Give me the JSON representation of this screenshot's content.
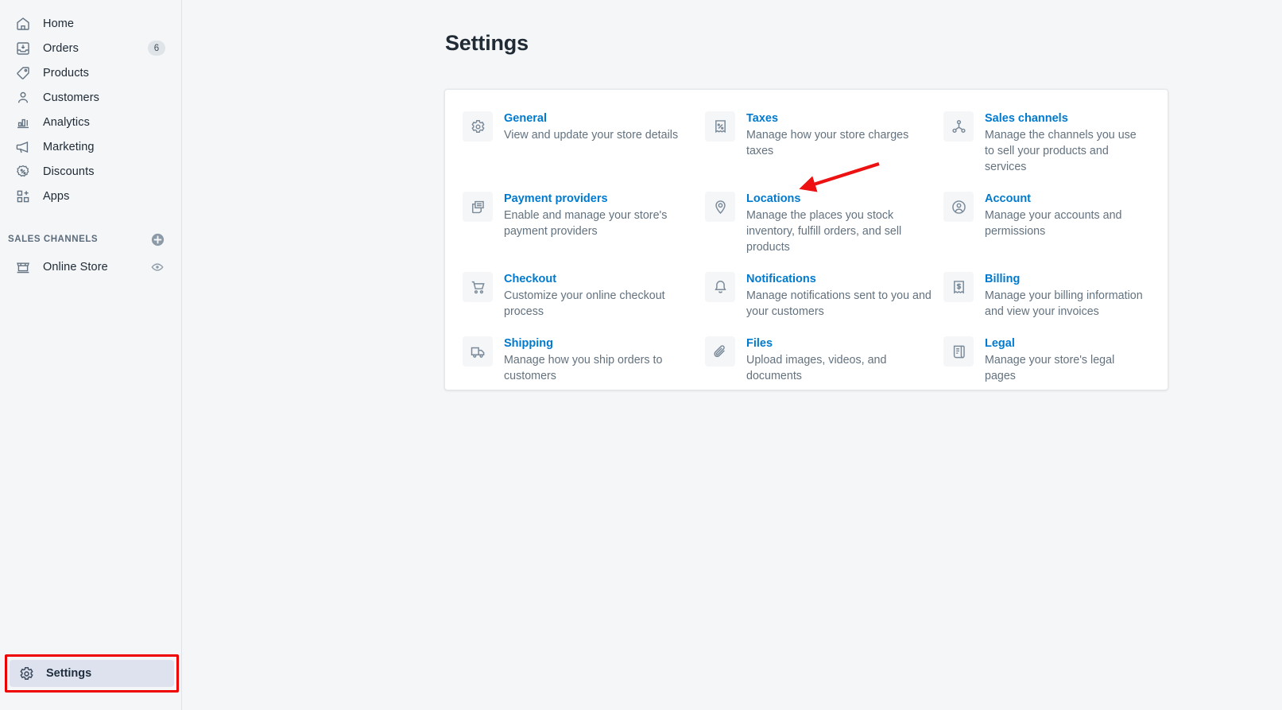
{
  "sidebar": {
    "items": [
      {
        "label": "Home",
        "icon": "home-icon",
        "badge": null
      },
      {
        "label": "Orders",
        "icon": "orders-icon",
        "badge": "6"
      },
      {
        "label": "Products",
        "icon": "products-tag-icon",
        "badge": null
      },
      {
        "label": "Customers",
        "icon": "customers-icon",
        "badge": null
      },
      {
        "label": "Analytics",
        "icon": "analytics-bar-chart-icon",
        "badge": null
      },
      {
        "label": "Marketing",
        "icon": "marketing-megaphone-icon",
        "badge": null
      },
      {
        "label": "Discounts",
        "icon": "discounts-percent-icon",
        "badge": null
      },
      {
        "label": "Apps",
        "icon": "apps-grid-plus-icon",
        "badge": null
      }
    ],
    "section": {
      "title": "SALES CHANNELS",
      "add_icon": "plus-circle-icon",
      "channels": [
        {
          "label": "Online Store",
          "icon": "online-store-icon",
          "action_icon": "eye-icon"
        }
      ]
    },
    "settings": {
      "label": "Settings",
      "icon": "gear-icon",
      "active": true,
      "highlight_color": "#ee0000",
      "active_bg": "#dde2ee"
    }
  },
  "main": {
    "title": "Settings",
    "tiles": [
      {
        "icon": "gear-icon",
        "title": "General",
        "desc": "View and update your store details"
      },
      {
        "icon": "taxes-receipt-percent-icon",
        "title": "Taxes",
        "desc": "Manage how your store charges taxes"
      },
      {
        "icon": "sales-channels-network-icon",
        "title": "Sales channels",
        "desc": "Manage the channels you use to sell your products and services"
      },
      {
        "icon": "payment-card-icon",
        "title": "Payment providers",
        "desc": "Enable and manage your store's payment providers"
      },
      {
        "icon": "location-pin-icon",
        "title": "Locations",
        "desc": "Manage the places you stock inventory, fulfill orders, and sell products"
      },
      {
        "icon": "account-person-circle-icon",
        "title": "Account",
        "desc": "Manage your accounts and permissions"
      },
      {
        "icon": "checkout-cart-icon",
        "title": "Checkout",
        "desc": "Customize your online checkout process"
      },
      {
        "icon": "notifications-bell-icon",
        "title": "Notifications",
        "desc": "Manage notifications sent to you and your customers"
      },
      {
        "icon": "billing-receipt-dollar-icon",
        "title": "Billing",
        "desc": "Manage your billing information and view your invoices"
      },
      {
        "icon": "shipping-truck-icon",
        "title": "Shipping",
        "desc": "Manage how you ship orders to customers"
      },
      {
        "icon": "files-paperclip-icon",
        "title": "Files",
        "desc": "Upload images, videos, and documents"
      },
      {
        "icon": "legal-scroll-icon",
        "title": "Legal",
        "desc": "Manage your store's legal pages"
      }
    ]
  },
  "annotation": {
    "arrow": {
      "color": "#ee1111",
      "points_at": "Locations"
    }
  },
  "colors": {
    "link": "#007ace",
    "text": "#212b36",
    "muted": "#63727f",
    "bg": "#f4f6f8",
    "card": "#ffffff",
    "highlight": "#ee0000"
  }
}
